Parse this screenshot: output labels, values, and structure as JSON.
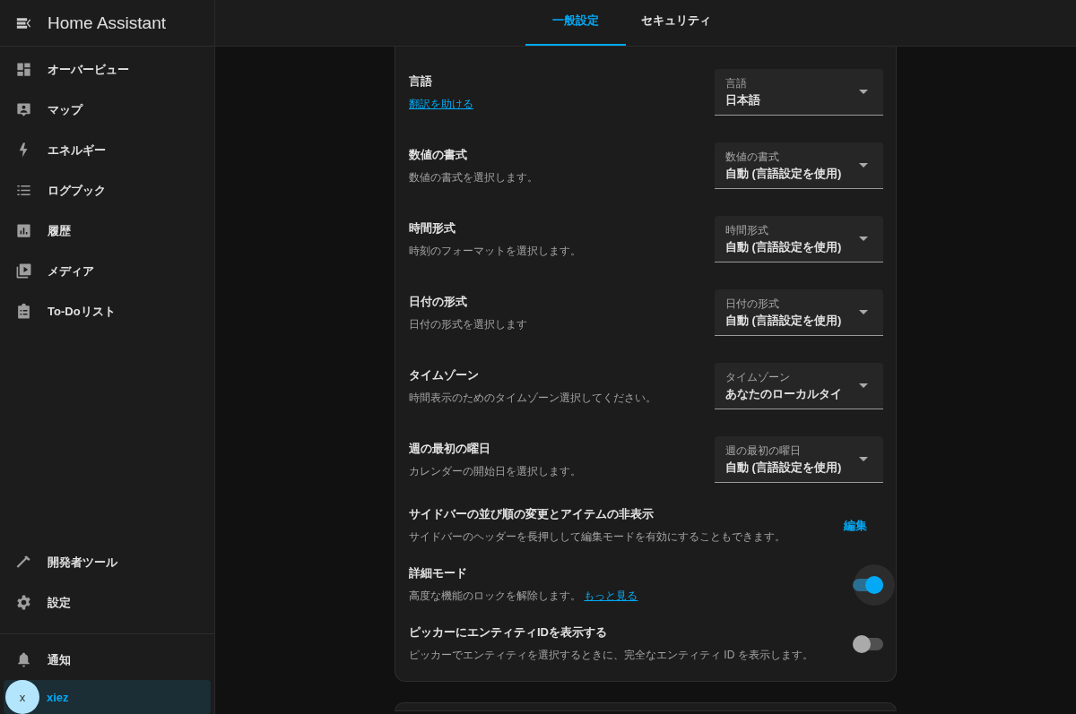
{
  "sidebar": {
    "title": "Home Assistant",
    "items": [
      {
        "label": "オーバービュー",
        "selected": false
      },
      {
        "label": "マップ",
        "selected": false
      },
      {
        "label": "エネルギー",
        "selected": false
      },
      {
        "label": "ログブック",
        "selected": false
      },
      {
        "label": "履歴",
        "selected": false
      },
      {
        "label": "メディア",
        "selected": false
      },
      {
        "label": "To-Doリスト",
        "selected": false
      }
    ],
    "bottom_items": [
      {
        "label": "開発者ツール",
        "selected": false
      },
      {
        "label": "設定",
        "selected": false
      }
    ],
    "notifications": {
      "label": "通知"
    },
    "user": {
      "initial": "x",
      "name": "xiez",
      "selected": true
    }
  },
  "tabs": [
    {
      "label": "一般設定",
      "selected": true
    },
    {
      "label": "セキュリティ",
      "selected": false
    }
  ],
  "settings": [
    {
      "kind": "select",
      "title": "言語",
      "link": "翻訳を助ける",
      "field_label": "言語",
      "value": "日本語"
    },
    {
      "kind": "select",
      "title": "数値の書式",
      "description": "数値の書式を選択します。",
      "field_label": "数値の書式",
      "value": "自動 (言語設定を使用)"
    },
    {
      "kind": "select",
      "title": "時間形式",
      "description": "時刻のフォーマットを選択します。",
      "field_label": "時間形式",
      "value": "自動 (言語設定を使用)"
    },
    {
      "kind": "select",
      "title": "日付の形式",
      "description": "日付の形式を選択します",
      "field_label": "日付の形式",
      "value": "自動 (言語設定を使用)"
    },
    {
      "kind": "select",
      "title": "タイムゾーン",
      "description": "時間表示のためのタイムゾーン選択してください。",
      "field_label": "タイムゾーン",
      "value": "あなたのローカルタイ"
    },
    {
      "kind": "select",
      "title": "週の最初の曜日",
      "description": "カレンダーの開始日を選択します。",
      "field_label": "週の最初の曜日",
      "value": "自動 (言語設定を使用)"
    },
    {
      "kind": "action",
      "title": "サイドバーの並び順の変更とアイテムの非表示",
      "description": "サイドバーのヘッダーを長押しして編集モードを有効にすることもできます。",
      "action": "編集"
    },
    {
      "kind": "toggle",
      "title": "詳細モード",
      "description": "高度な機能のロックを解除します。",
      "link": "もっと見る",
      "on": true,
      "focused": true
    },
    {
      "kind": "toggle",
      "title": "ピッカーにエンティティIDを表示する",
      "description": "ピッカーでエンティティを選択するときに、完全なエンティティ ID を表示します。",
      "on": false,
      "focused": false
    }
  ]
}
